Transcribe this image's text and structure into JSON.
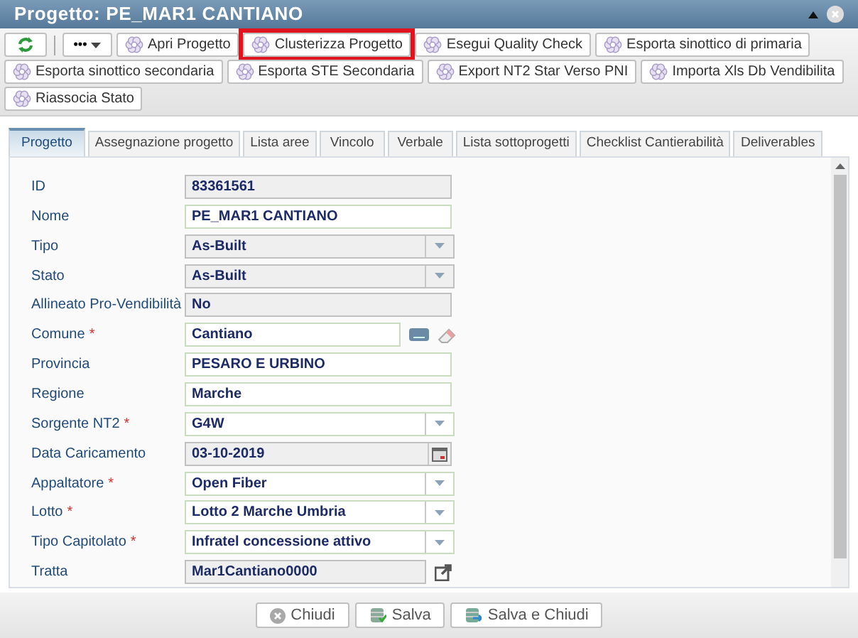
{
  "window": {
    "title": "Progetto: PE_MAR1 CANTIANO"
  },
  "toolbar": {
    "buttons": [
      {
        "label": "Apri Progetto",
        "highlighted": false
      },
      {
        "label": "Clusterizza Progetto",
        "highlighted": true
      },
      {
        "label": "Esegui Quality Check",
        "highlighted": false
      },
      {
        "label": "Esporta sinottico di primaria",
        "highlighted": false
      },
      {
        "label": "Esporta sinottico secondaria",
        "highlighted": false
      },
      {
        "label": "Esporta STE Secondaria",
        "highlighted": false
      },
      {
        "label": "Export NT2 Star Verso PNI",
        "highlighted": false
      },
      {
        "label": "Importa Xls Db Vendibilita",
        "highlighted": false
      },
      {
        "label": "Riassocia Stato",
        "highlighted": false
      }
    ],
    "more": "•••"
  },
  "tabs": [
    {
      "label": "Progetto",
      "selected": true
    },
    {
      "label": "Assegnazione progetto",
      "selected": false
    },
    {
      "label": "Lista aree",
      "selected": false
    },
    {
      "label": "Vincolo",
      "selected": false
    },
    {
      "label": "Verbale",
      "selected": false
    },
    {
      "label": "Lista sottoprogetti",
      "selected": false
    },
    {
      "label": "Checklist Cantierabilità",
      "selected": false
    },
    {
      "label": "Deliverables",
      "selected": false
    }
  ],
  "fields": [
    {
      "label": "ID",
      "value": "83361561",
      "kind": "readonly"
    },
    {
      "label": "Nome",
      "value": "PE_MAR1 CANTIANO",
      "kind": "text"
    },
    {
      "label": "Tipo",
      "value": "As-Built",
      "kind": "select",
      "disabled": true
    },
    {
      "label": "Stato",
      "value": "As-Built",
      "kind": "select",
      "disabled": true
    },
    {
      "label": "Allineato Pro-Vendibilità",
      "value": "No",
      "kind": "readonly"
    },
    {
      "label": "Comune",
      "required_mark": "*",
      "value": "Cantiano",
      "kind": "lookup"
    },
    {
      "label": "Provincia",
      "value": "PESARO E URBINO",
      "kind": "text"
    },
    {
      "label": "Regione",
      "value": "Marche",
      "kind": "text"
    },
    {
      "label": "Sorgente NT2",
      "required_mark": "*",
      "value": "G4W",
      "kind": "select",
      "disabled": false
    },
    {
      "label": "Data Caricamento",
      "value": "03-10-2019",
      "kind": "date"
    },
    {
      "label": "Appaltatore",
      "required_mark": "*",
      "value": "Open Fiber",
      "kind": "select",
      "disabled": false
    },
    {
      "label": "Lotto",
      "required_mark": "*",
      "value": "Lotto 2 Marche Umbria",
      "kind": "select",
      "disabled": false
    },
    {
      "label": "Tipo Capitolato",
      "required_mark": "*",
      "value": "Infratel concessione attivo",
      "kind": "select",
      "disabled": false
    },
    {
      "label": "Tratta",
      "value": "Mar1Cantiano0000",
      "kind": "link"
    }
  ],
  "footer": [
    {
      "label": "Chiudi",
      "kind": "close"
    },
    {
      "label": "Salva",
      "kind": "save"
    },
    {
      "label": "Salva e Chiudi",
      "kind": "save-close"
    }
  ]
}
